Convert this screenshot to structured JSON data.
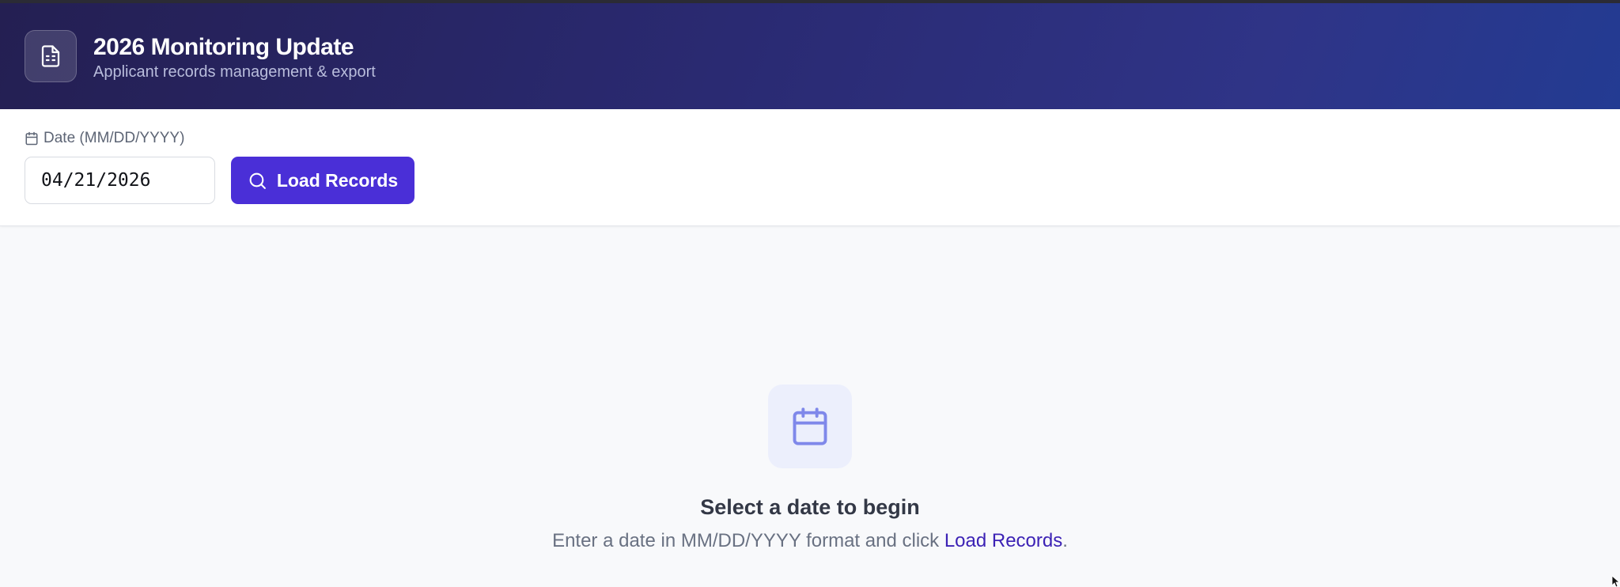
{
  "header": {
    "title": "2026 Monitoring Update",
    "subtitle": "Applicant records management & export",
    "logo_icon": "document-icon"
  },
  "toolbar": {
    "date_label": "Date (MM/DD/YYYY)",
    "date_label_icon": "calendar-icon",
    "date_value": "04/21/2026",
    "load_button_label": "Load Records",
    "load_button_icon": "search-icon"
  },
  "empty_state": {
    "icon": "calendar-icon",
    "title": "Select a date to begin",
    "desc_prefix": "Enter a date in MM/DD/YYYY format and click ",
    "desc_link": "Load Records",
    "desc_suffix": "."
  },
  "colors": {
    "accent": "#4a2fd7",
    "header_start": "#241f52",
    "header_end": "#233b92",
    "link": "#3c22b5"
  }
}
